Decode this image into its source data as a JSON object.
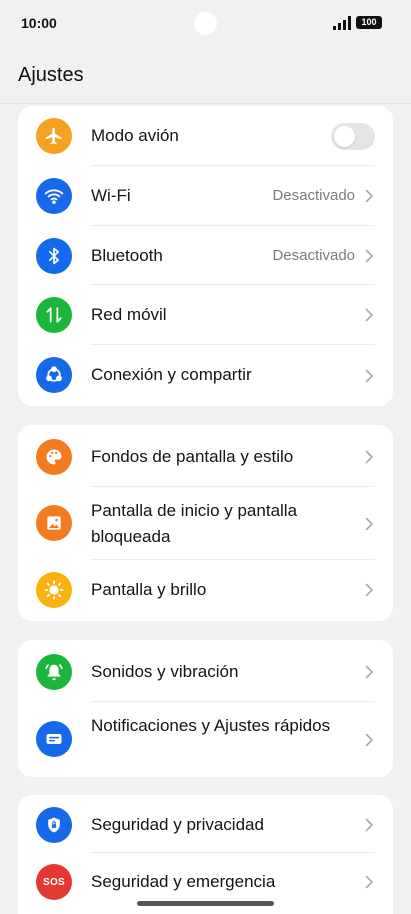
{
  "status_bar": {
    "time": "10:00",
    "battery": "100"
  },
  "header": {
    "title": "Ajustes"
  },
  "colors": {
    "orange": "#f7a120",
    "blue": "#1669e8",
    "green": "#1ab53b",
    "palette_orange": "#f47b20",
    "sun_yellow": "#f9b210",
    "red": "#e23a33"
  },
  "groups": [
    {
      "items": [
        {
          "label": "Modo avión",
          "icon": "airplane-icon",
          "toggle": "off"
        },
        {
          "label": "Wi-Fi",
          "icon": "wifi-icon",
          "value": "Desactivado"
        },
        {
          "label": "Bluetooth",
          "icon": "bluetooth-icon",
          "value": "Desactivado"
        },
        {
          "label": "Red móvil",
          "icon": "mobile-data-icon"
        },
        {
          "label": "Conexión y compartir",
          "icon": "share-connection-icon"
        }
      ]
    },
    {
      "items": [
        {
          "label": "Fondos de pantalla y estilo",
          "icon": "palette-icon"
        },
        {
          "label": "Pantalla de inicio y pantalla bloqueada",
          "icon": "home-lock-screen-icon"
        },
        {
          "label": "Pantalla y brillo",
          "icon": "brightness-icon"
        }
      ]
    },
    {
      "items": [
        {
          "label": "Sonidos y vibración",
          "icon": "bell-icon"
        },
        {
          "label": "Notificaciones y Ajustes rápidos",
          "icon": "notifications-icon"
        }
      ]
    },
    {
      "items": [
        {
          "label": "Seguridad y privacidad",
          "icon": "security-icon"
        },
        {
          "label": "Seguridad y emergencia",
          "icon": "sos-icon",
          "icon_text": "SOS"
        }
      ]
    }
  ]
}
